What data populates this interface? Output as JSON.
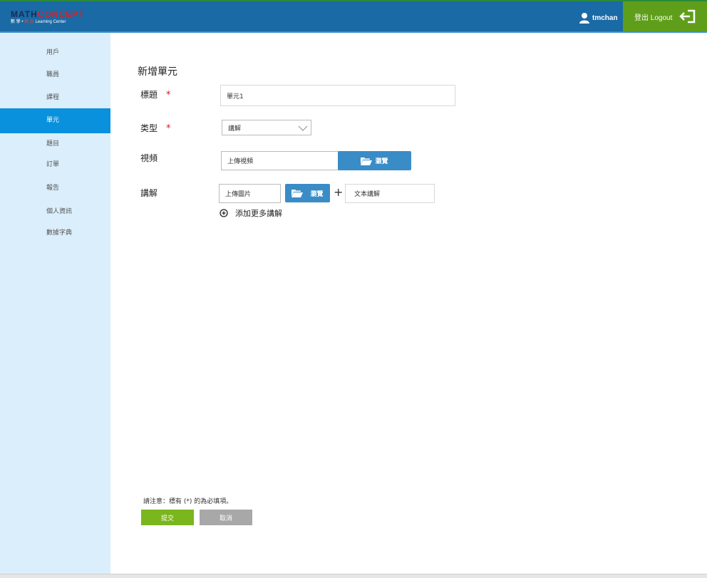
{
  "header": {
    "logo_line1_a": "MATH",
    "logo_line1_b": "CONCEPT",
    "logo_line2_a": "數 學 • ",
    "logo_line2_b": "概 念",
    "logo_line2_c": " Learning Center",
    "username": "tmchan",
    "logout_label": "登出 Logout",
    "colors": {
      "bar": "#1a6aa5",
      "logout": "#5f9e1b"
    }
  },
  "sidebar": {
    "items": [
      {
        "label": "用戶"
      },
      {
        "label": "職員"
      },
      {
        "label": "課程"
      },
      {
        "label": "單元"
      },
      {
        "label": "題目"
      },
      {
        "label": "訂單"
      },
      {
        "label": "報告"
      },
      {
        "label": "個人資訊"
      },
      {
        "label": "數據字典"
      }
    ],
    "active_label": "單元",
    "active_color": "#0a91dd"
  },
  "form": {
    "title": "新增單元",
    "title_label": "標題",
    "title_value": "單元1",
    "type_label": "类型",
    "type_value": "講解",
    "video_label": "視頻",
    "video_placeholder": "上傳視頻",
    "video_browse": "瀏覽",
    "explain_label": "講解",
    "image_placeholder": "上傳圖片",
    "image_browse": "瀏覽",
    "plus_symbol": "+",
    "text_placeholder": "文本講解",
    "add_more": "添加更多講解",
    "required_mark": "*"
  },
  "footer": {
    "note": "請注意：標有 (*) 的為必填項。",
    "submit": "提交",
    "cancel": "取消"
  }
}
